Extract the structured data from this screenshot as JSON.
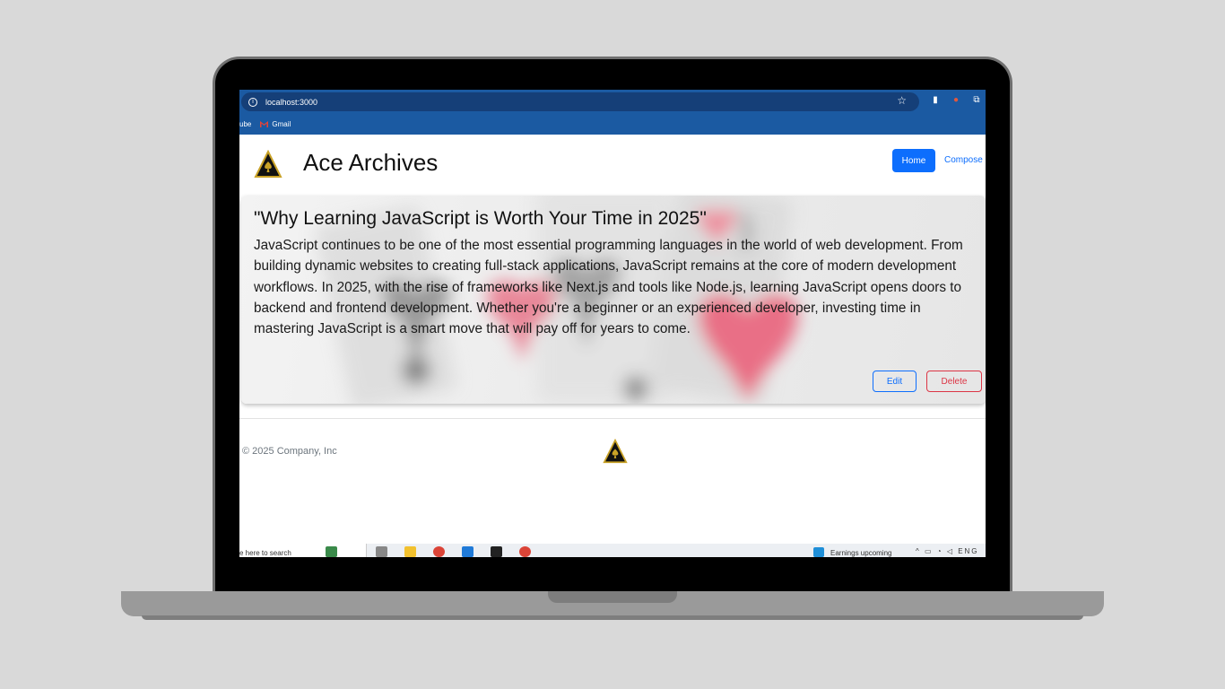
{
  "browser": {
    "url": "localhost:3000",
    "bookmarks": [
      {
        "label": "ube"
      },
      {
        "label": "Gmail"
      }
    ]
  },
  "navbar": {
    "brand": "Ace Archives",
    "home_label": "Home",
    "compose_label": "Compose"
  },
  "post": {
    "title": "\"Why Learning JavaScript is Worth Your Time in 2025\"",
    "body": "JavaScript continues to be one of the most essential programming languages in the world of web development. From building dynamic websites to creating full-stack applications, JavaScript remains at the core of modern development workflows. In 2025, with the rise of frameworks like Next.js and tools like Node.js, learning JavaScript opens doors to backend and frontend development. Whether you're a beginner or an experienced developer, investing time in mastering JavaScript is a smart move that will pay off for years to come.",
    "edit_label": "Edit",
    "delete_label": "Delete"
  },
  "footer": {
    "copyright": "© 2025 Company, Inc"
  },
  "taskbar": {
    "search_placeholder": "e here to search",
    "weather_text": "Earnings upcoming",
    "tray_text": "ENG"
  },
  "colors": {
    "primary": "#0d6efd",
    "danger": "#dc3545",
    "browser_bar": "#1b5aa2",
    "logo_gold": "#c9a227"
  }
}
